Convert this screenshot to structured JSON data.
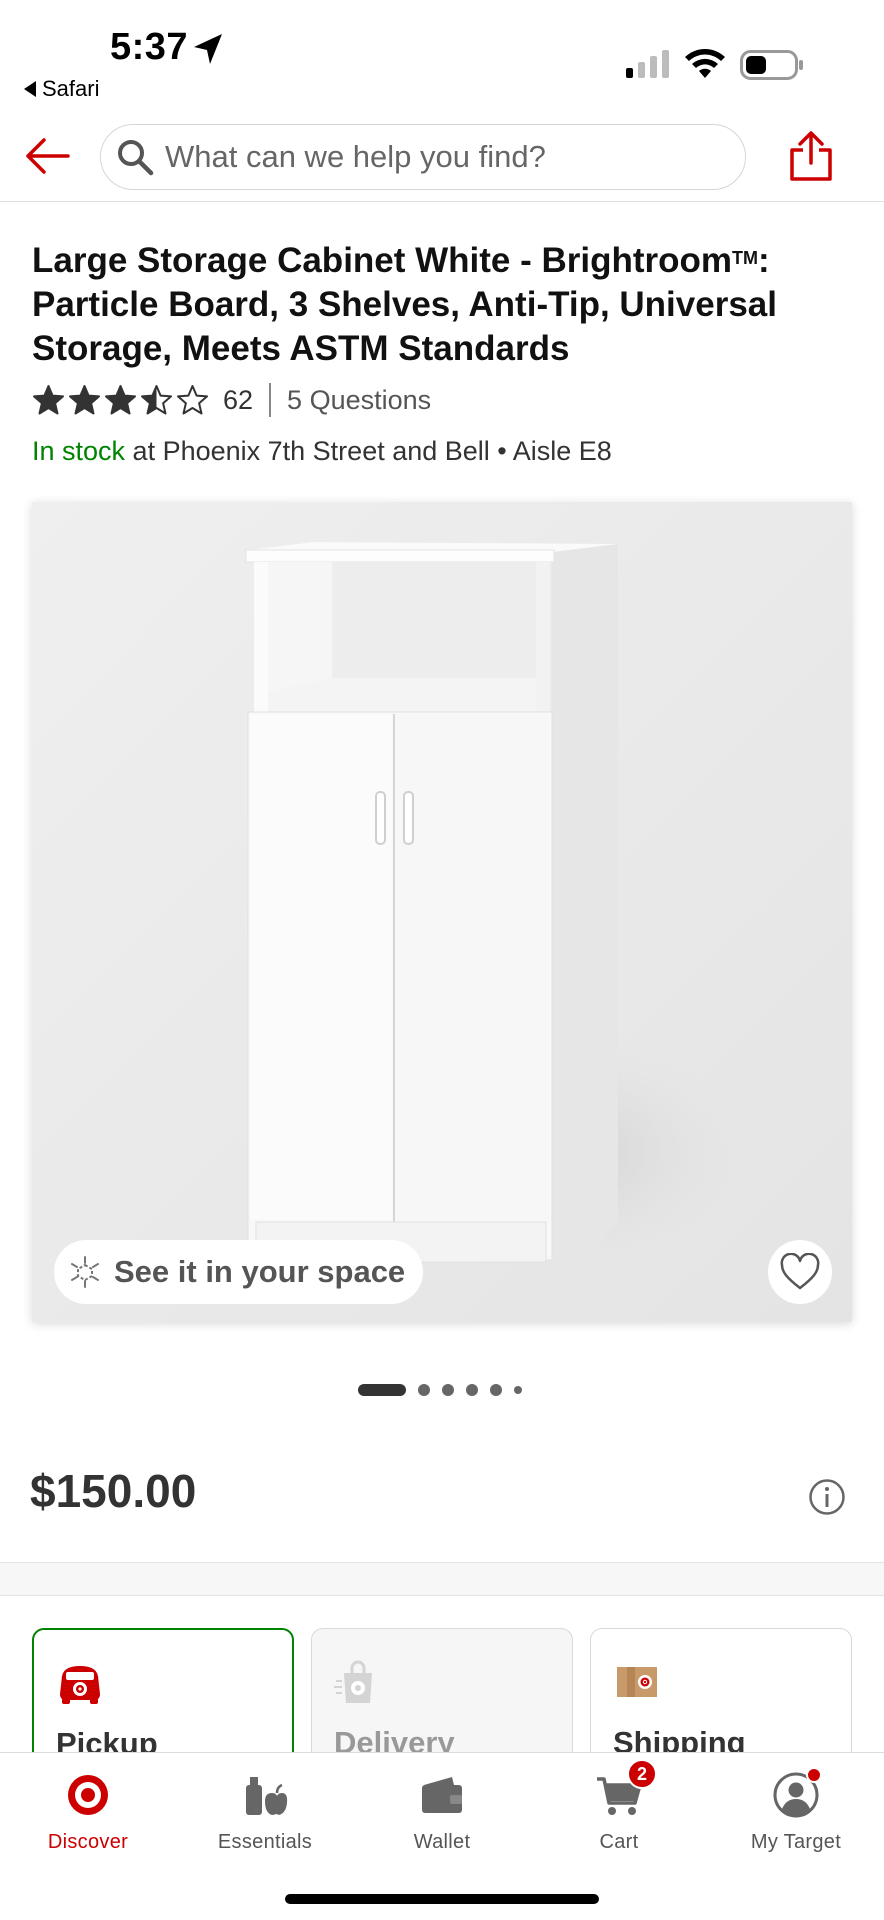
{
  "status_bar": {
    "time": "5:37",
    "back_app": "Safari",
    "signal_bars_active": 1,
    "signal_bars_total": 4
  },
  "header": {
    "search_placeholder": "What can we help you find?"
  },
  "product": {
    "title": "Large Storage Cabinet White - Brightroom",
    "trademark": "TM",
    "title_rest": ": Particle Board, 3 Shelves, Anti-Tip, Universal Storage, Meets ASTM Standards",
    "rating": 3.5,
    "rating_max": 5,
    "rating_count": "62",
    "questions": "5 Questions",
    "stock_status": "In stock",
    "stock_location": " at Phoenix 7th Street and Bell • Aisle E8",
    "ar_label": "See it in your space",
    "image_count": 6,
    "active_image_index": 0,
    "price": "$150.00"
  },
  "fulfillment": [
    {
      "label": "Pickup",
      "state": "selected"
    },
    {
      "label": "Delivery",
      "state": "disabled"
    },
    {
      "label": "Shipping",
      "state": "available"
    }
  ],
  "tabs": [
    {
      "label": "Discover",
      "icon": "target-bullseye-icon",
      "active": true
    },
    {
      "label": "Essentials",
      "icon": "essentials-icon",
      "active": false
    },
    {
      "label": "Wallet",
      "icon": "wallet-icon",
      "active": false
    },
    {
      "label": "Cart",
      "icon": "cart-icon",
      "active": false,
      "badge": "2"
    },
    {
      "label": "My Target",
      "icon": "account-icon",
      "active": false
    }
  ],
  "colors": {
    "brand_red": "#cc0000",
    "in_stock_green": "#008300",
    "text_dark": "#333333"
  }
}
